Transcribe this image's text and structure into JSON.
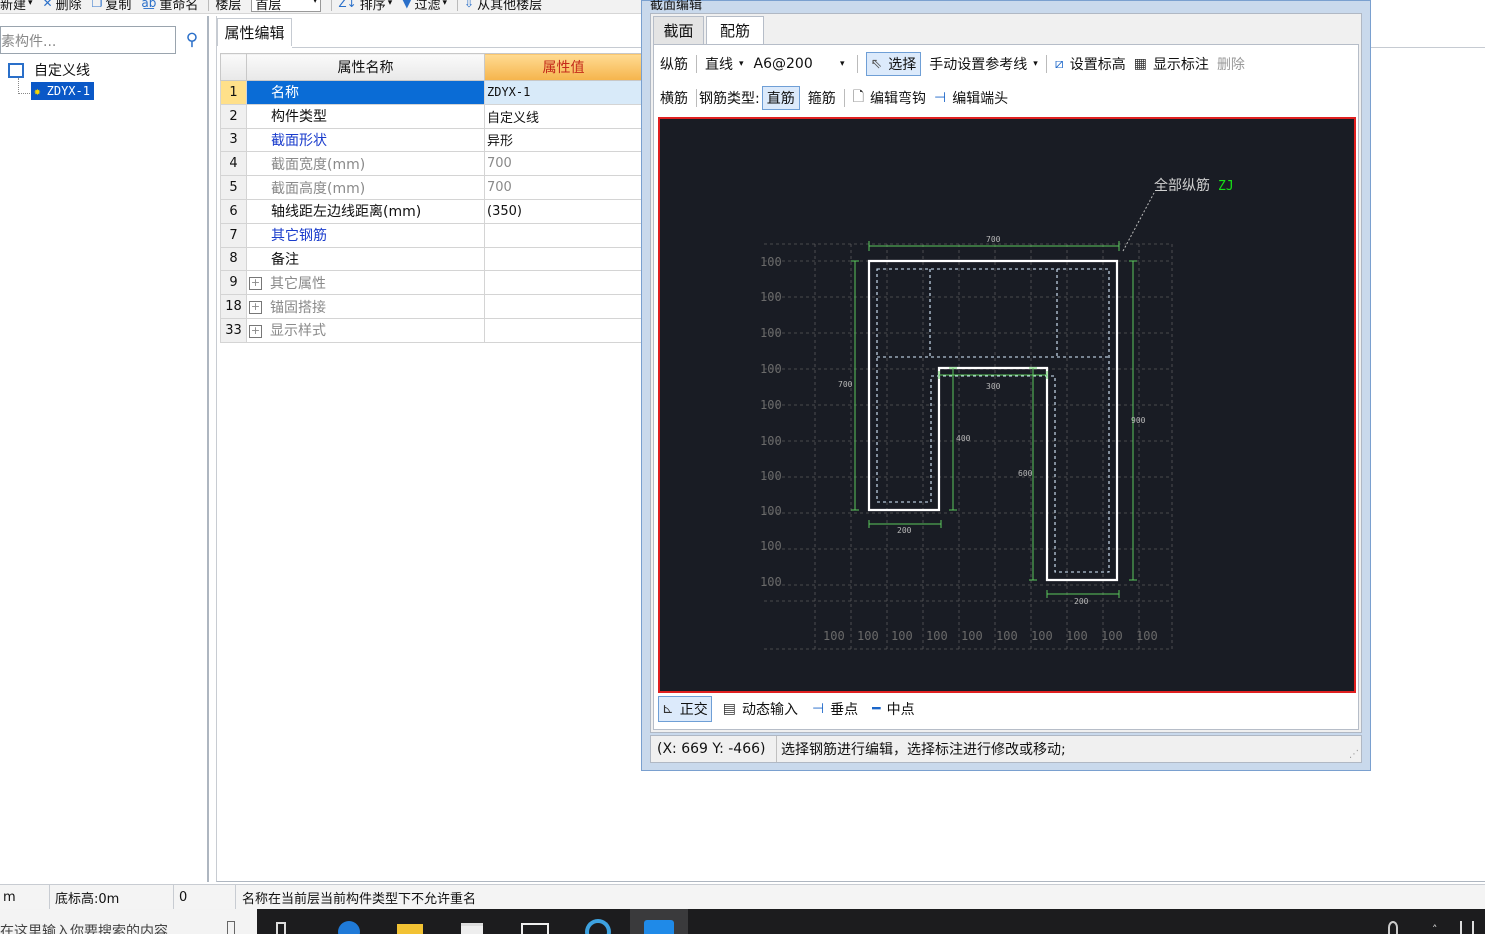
{
  "toolbar": {
    "new_label": "新建",
    "delete_label": "删除",
    "copy_label": "复制",
    "rename_label": "重命名",
    "floor_label": "楼层",
    "floor_value": "首层",
    "sort_label": "排序",
    "filter_label": "过滤",
    "copy_from_floor_label": "从其他楼层"
  },
  "left_panel": {
    "search_placeholder": "素构件...",
    "tree_root": "自定义线",
    "tree_child": "ZDYX-1"
  },
  "property_panel": {
    "tab_label": "属性编辑",
    "columns": [
      "属性名称",
      "属性值"
    ],
    "rows": [
      {
        "num": "1",
        "name": "名称",
        "value": "ZDYX-1"
      },
      {
        "num": "2",
        "name": "构件类型",
        "value": "自定义线"
      },
      {
        "num": "3",
        "name": "截面形状",
        "value": "异形"
      },
      {
        "num": "4",
        "name": "截面宽度(mm)",
        "value": "700"
      },
      {
        "num": "5",
        "name": "截面高度(mm)",
        "value": "700"
      },
      {
        "num": "6",
        "name": "轴线距左边线距离(mm)",
        "value": "(350)"
      },
      {
        "num": "7",
        "name": "其它钢筋",
        "value": ""
      },
      {
        "num": "8",
        "name": "备注",
        "value": ""
      },
      {
        "num": "9",
        "name": "其它属性",
        "value": ""
      },
      {
        "num": "18",
        "name": "锚固搭接",
        "value": ""
      },
      {
        "num": "33",
        "name": "显示样式",
        "value": ""
      }
    ]
  },
  "status_bar": {
    "unit": "m",
    "base_elev": "底标高:0m",
    "zero": "0",
    "message": "名称在当前层当前构件类型下不允许重名"
  },
  "taskbar": {
    "search_text": "在这里输入你要搜索的内容"
  },
  "dialog": {
    "title": "截面编辑",
    "tabs": [
      "截面",
      "配筋"
    ],
    "row1": {
      "longitudinal": "纵筋",
      "line_mode": "直线",
      "spec": "A6@200",
      "select": "选择",
      "manual_ref": "手动设置参考线",
      "set_elev": "设置标高",
      "show_marks": "显示标注",
      "delete": "删除"
    },
    "row2": {
      "transverse": "横筋",
      "rebar_type_label": "钢筋类型:",
      "straight": "直筋",
      "stirrup": "箍筋",
      "edit_hook": "编辑弯钩",
      "edit_end": "编辑端头"
    },
    "canvas": {
      "annotation_text": "全部纵筋",
      "annotation_code": "ZJ",
      "dim_top": "700",
      "dim_left": "700",
      "dim_inner_top": "300",
      "dim_inner_left": "400",
      "dim_inner_right": "600",
      "dim_right": "900",
      "dim_bottom_left": "200",
      "dim_bottom_right": "200",
      "grid_row_labels": [
        "100",
        "100",
        "100",
        "100",
        "100",
        "100",
        "100",
        "100",
        "100",
        "100"
      ],
      "grid_col_labels": [
        "100",
        "100",
        "100",
        "100",
        "100",
        "100",
        "100",
        "100",
        "100",
        "100"
      ]
    },
    "snap": {
      "ortho": "正交",
      "dynamic_input": "动态输入",
      "perpendicular": "垂点",
      "midpoint": "中点"
    },
    "status": {
      "coords": "(X: 669 Y: -466)",
      "hint": "选择钢筋进行编辑，选择标注进行修改或移动;"
    }
  },
  "colors": {
    "canvas_bg": "#191c24",
    "selection_blue": "#0a6cd6",
    "dimension_green": "#5cc85c",
    "highlight_red": "#e02020",
    "zj_green": "#18e018"
  }
}
